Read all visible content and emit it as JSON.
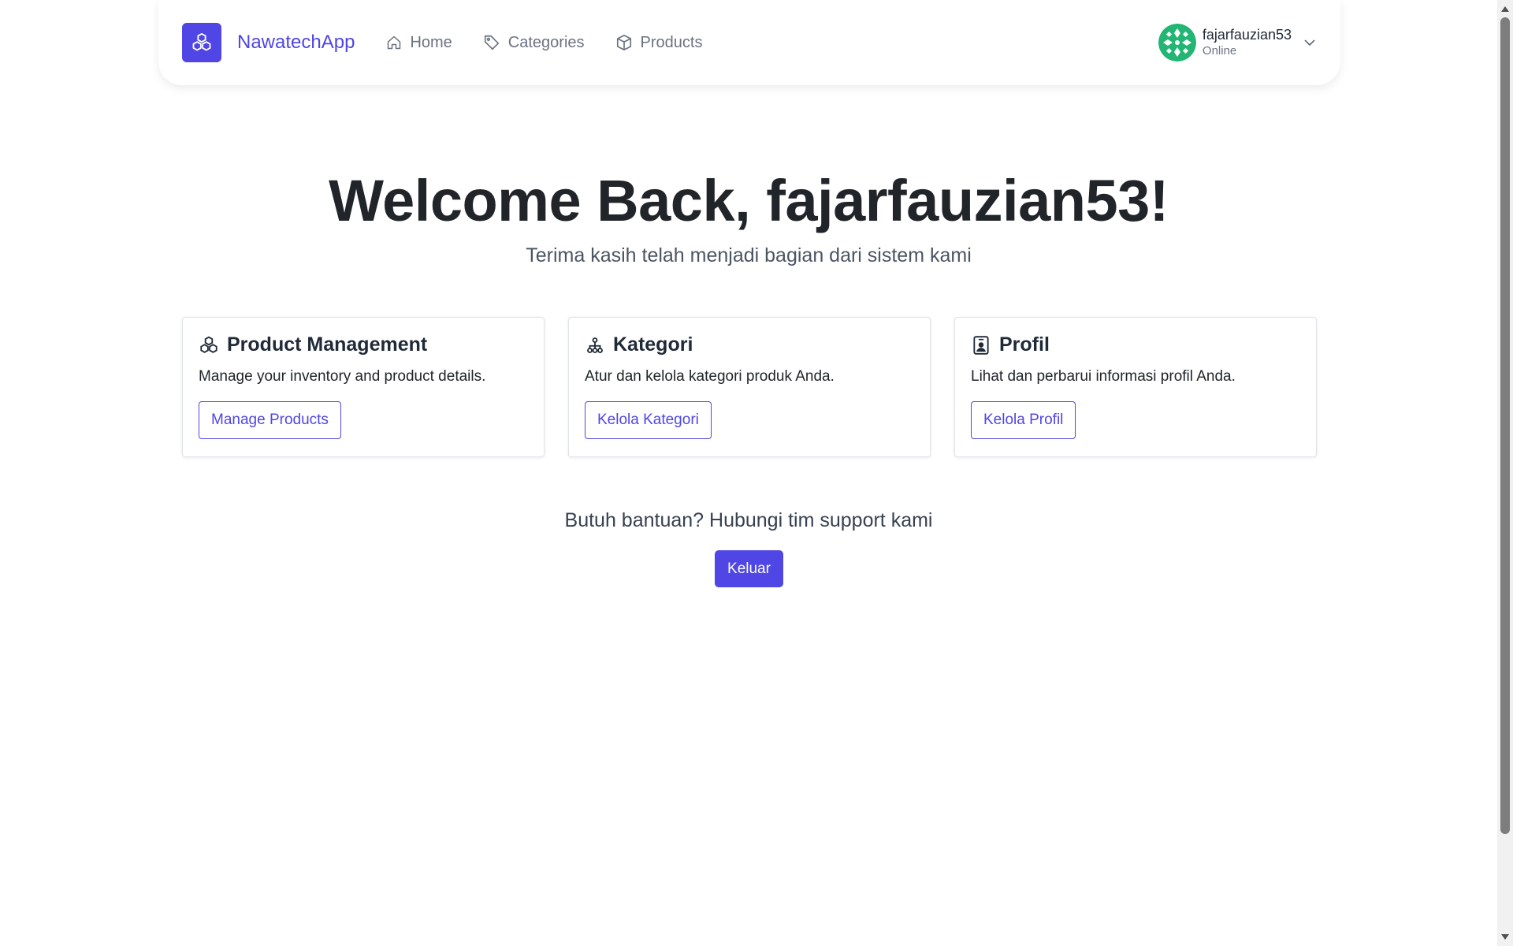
{
  "navbar": {
    "brand": "NawatechApp",
    "links": [
      {
        "label": "Home",
        "icon": "home-icon"
      },
      {
        "label": "Categories",
        "icon": "tag-icon"
      },
      {
        "label": "Products",
        "icon": "box-icon"
      }
    ],
    "user": {
      "name": "fajarfauzian53",
      "status": "Online"
    }
  },
  "hero": {
    "title": "Welcome Back, fajarfauzian53!",
    "subtitle": "Terima kasih telah menjadi bagian dari sistem kami"
  },
  "cards": [
    {
      "title": "Product Management",
      "text": "Manage your inventory and product details.",
      "button": "Manage Products",
      "icon": "boxes-icon"
    },
    {
      "title": "Kategori",
      "text": "Atur dan kelola kategori produk Anda.",
      "button": "Kelola Kategori",
      "icon": "hierarchy-icon"
    },
    {
      "title": "Profil",
      "text": "Lihat dan perbarui informasi profil Anda.",
      "button": "Kelola Profil",
      "icon": "person-badge-icon"
    }
  ],
  "help": "Butuh bantuan? Hubungi tim support kami",
  "logout_label": "Keluar",
  "colors": {
    "accent": "#4f46e5",
    "avatar": "#22b573"
  }
}
